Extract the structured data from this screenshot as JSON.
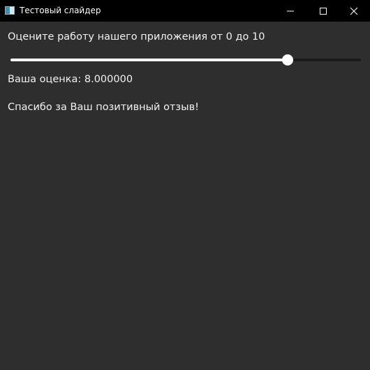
{
  "window": {
    "title": "Тестовый слайдер",
    "icon": "app-window-icon",
    "controls": {
      "minimize_icon": "minimize-icon",
      "maximize_icon": "maximize-icon",
      "close_icon": "close-icon"
    }
  },
  "main": {
    "prompt": "Оцените работу нашего приложения от 0 до 10",
    "slider": {
      "min": 0,
      "max": 10,
      "value": 8
    },
    "score_text": "Ваша оценка: 8.000000",
    "feedback_text": "Спасибо за Ваш позитивный отзыв!"
  },
  "colors": {
    "background": "#2e2e2e",
    "titlebar": "#000000",
    "text": "#f2f2f2",
    "slider_fill": "#ffffff",
    "slider_track": "#1a1a1a"
  }
}
